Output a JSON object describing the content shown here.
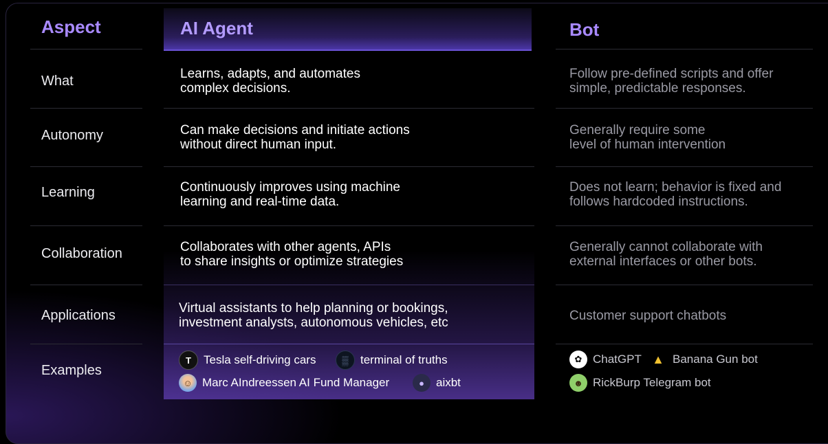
{
  "headers": {
    "aspect": "Aspect",
    "agent": "AI Agent",
    "bot": "Bot"
  },
  "rows": [
    {
      "label": "What",
      "agent": [
        "Learns, adapts, and automates",
        "complex decisions."
      ],
      "bot": [
        "Follow pre-defined scripts and offer",
        "simple, predictable responses."
      ]
    },
    {
      "label": "Autonomy",
      "agent": [
        "Can make decisions and initiate actions",
        "without direct human input."
      ],
      "bot": [
        "Generally require some",
        "level of human intervention"
      ]
    },
    {
      "label": "Learning",
      "agent": [
        "Continuously improves using machine",
        "learning and real-time data."
      ],
      "bot": [
        "Does not learn; behavior is fixed and",
        "follows hardcoded instructions."
      ]
    },
    {
      "label": "Collaboration",
      "agent": [
        "Collaborates with other agents, APIs",
        "to share insights or optimize strategies"
      ],
      "bot": [
        "Generally cannot collaborate with",
        "external interfaces or other bots."
      ]
    },
    {
      "label": "Applications",
      "agent": [
        "Virtual assistants to help planning or bookings,",
        "investment analysts, autonomous vehicles, etc"
      ],
      "bot": [
        "Customer support chatbots"
      ]
    }
  ],
  "examples": {
    "label": "Examples",
    "agent": [
      {
        "text": "Tesla self-driving cars",
        "icon": "tesla-logo-icon"
      },
      {
        "text": "terminal of truths",
        "icon": "terminal-of-truths-icon"
      },
      {
        "text": "Marc AIndreessen AI Fund Manager",
        "icon": "marc-aindreessen-avatar-icon"
      },
      {
        "text": "aixbt",
        "icon": "aixbt-avatar-icon"
      }
    ],
    "bot": [
      {
        "text": "ChatGPT",
        "icon": "chatgpt-logo-icon"
      },
      {
        "text": "Banana Gun bot",
        "icon": "banana-gun-icon"
      },
      {
        "text": "RickBurp Telegram bot",
        "icon": "rickburp-avatar-icon"
      }
    ]
  },
  "colors": {
    "accent": "#a98aff",
    "background": "#000000",
    "muted_text": "#9a9aa4"
  }
}
